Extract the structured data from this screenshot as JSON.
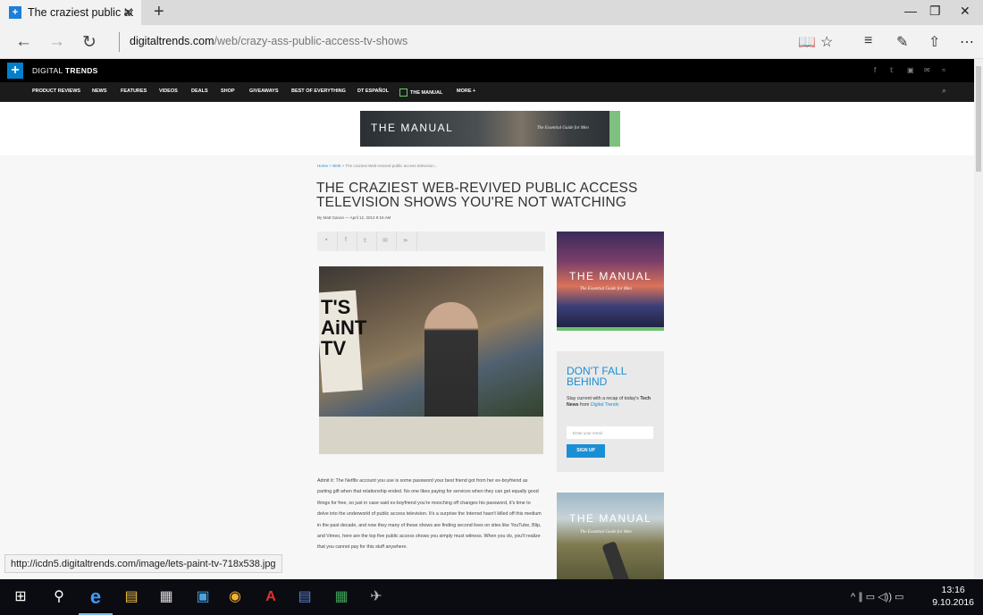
{
  "browser": {
    "tab_title": "The craziest public acce",
    "tab_close": "✕",
    "new_tab": "+",
    "url_domain": "digitaltrends.com",
    "url_path": "/web/crazy-ass-public-access-tv-shows",
    "back": "←",
    "forward": "→",
    "refresh": "↻",
    "win_min": "—",
    "win_restore": "❐",
    "win_close": "✕",
    "tools": {
      "reading": "📖",
      "favorite": "☆",
      "hub": "≡",
      "note": "✎",
      "share": "⇧",
      "more": "⋯"
    }
  },
  "site": {
    "logo": "+",
    "name_light": "DIGITAL ",
    "name_bold": "TRENDS",
    "social": [
      "f",
      "𝕥",
      "▣",
      "✉",
      "≈"
    ],
    "nav": [
      "PRODUCT REVIEWS",
      "NEWS",
      "FEATURES",
      "VIDEOS",
      "DEALS",
      "SHOP",
      "GIVEAWAYS",
      "BEST OF EVERYTHING",
      "DT ESPAÑOL",
      "THE MANUAL",
      "MORE +"
    ],
    "search_icon": "⌕"
  },
  "banner": {
    "title": "THE MANUAL",
    "subtitle": "The Essential Guide for Men"
  },
  "article": {
    "breadcrumb": [
      "Home",
      "Web",
      "The craziest Web-revived public access television..."
    ],
    "title": "THE CRAZIEST WEB-REVIVED PUBLIC ACCESS TELEVISION SHOWS YOU'RE NOT WATCHING",
    "byline": "By Matt Ganon — April 12, 2013 9:15 AM",
    "share_icons": [
      "▪",
      "f",
      "𝕥",
      "✉",
      "⋗"
    ],
    "image_sign": "T'S\nAiNT\nTV",
    "body": "Admit it: The Netflix account you use is some password your best friend got from her ex-boyfriend as parting gift when that relationship ended. No one likes paying for services when they can get equally good things for free, so just in case said ex-boyfriend you're mooching off changes his password, it's time to delve into the underworld of public access television. It's a surprise the Internet hasn't killed off this medium in the past decade, and now they many of these shows are finding second lives on sites like YouTube, Blip, and Vimeo, here are the top five public access shows you simply must witness. When you do, you'll realize that you cannot pay for this stuff anywhere."
  },
  "sidebar": {
    "ad1_title": "THE MANUAL",
    "ad1_subtitle": "The Essential Guide for Men",
    "newsletter_heading": "DON'T FALL BEHIND",
    "newsletter_text_1": "Stay current with a recap of today's ",
    "newsletter_text_bold": "Tech News",
    "newsletter_text_2": " from ",
    "newsletter_text_brand": "Digital Trends",
    "email_placeholder": "Enter your email",
    "signup": "SIGN UP",
    "ad2_title": "THE MANUAL",
    "ad2_subtitle": "The Essential Guide for Men"
  },
  "status_url": "http://icdn5.digitaltrends.com/image/lets-paint-tv-718x538.jpg",
  "taskbar": {
    "icons": [
      "⊞",
      "⚲",
      "e",
      "▤",
      "▦",
      "▣",
      "◉",
      "A",
      "▤",
      "▦",
      "✈"
    ],
    "tray": "^ ∥ ▭ ◁)) ▭",
    "time": "13:16",
    "date": "9.10.2016"
  }
}
